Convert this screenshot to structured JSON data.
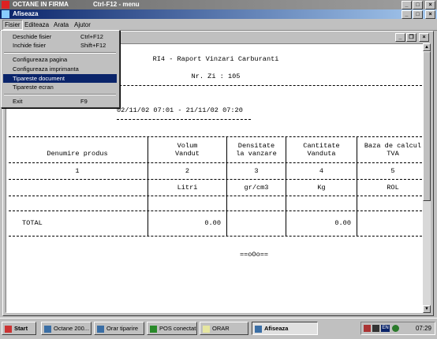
{
  "outer_window": {
    "title": "OCTANE IN FIRMA",
    "subtitle": "Ctrl-F12 - menu"
  },
  "inner_window": {
    "title": "Afiseaza"
  },
  "menubar": [
    "Fisier",
    "Editeaza",
    "Arata",
    "Ajutor"
  ],
  "file_menu": [
    {
      "label": "Deschide fisier",
      "shortcut": "Ctrl+F12"
    },
    {
      "label": "Inchide fisier",
      "shortcut": "Shift+F12"
    },
    {
      "label": "Configureaza pagina",
      "shortcut": ""
    },
    {
      "label": "Configureaza imprimanta",
      "shortcut": ""
    },
    {
      "label": "Tipareste document",
      "shortcut": ""
    },
    {
      "label": "Tipareste ecran",
      "shortcut": ""
    },
    {
      "label": "Exit",
      "shortcut": "F9"
    }
  ],
  "report": {
    "title": "RI4 - Raport Vinzari Carburanti",
    "nr_zi": "Nr. Zi : 105",
    "period": "02/11/02 07:01 - 21/11/02 07:20",
    "headers": [
      {
        "l1": "",
        "l2": "Denumire produs"
      },
      {
        "l1": "Volum",
        "l2": "Vandut"
      },
      {
        "l1": "Densitate",
        "l2": "la vanzare"
      },
      {
        "l1": "Cantitate",
        "l2": "Vanduta"
      },
      {
        "l1": "Baza de calcul",
        "l2": "TVA"
      }
    ],
    "col_numbers": [
      "1",
      "2",
      "3",
      "4",
      "5"
    ],
    "units": [
      "",
      "Litri",
      "gr/cm3",
      "Kg",
      "ROL"
    ],
    "total_label": "TOTAL",
    "total_volum": "0.00",
    "total_cantitate": "0.00",
    "end_mark": "==oOo=="
  },
  "taskbar": {
    "start": "Start",
    "items": [
      "Octane 200...",
      "Orar tiparire",
      "POS conectat",
      "ORAR",
      "Afiseaza"
    ],
    "lang": "EN",
    "clock": "07:29"
  },
  "colors": {
    "title_active": "#0a246a",
    "title_inactive": "#808080",
    "highlight": "#0a246a"
  }
}
